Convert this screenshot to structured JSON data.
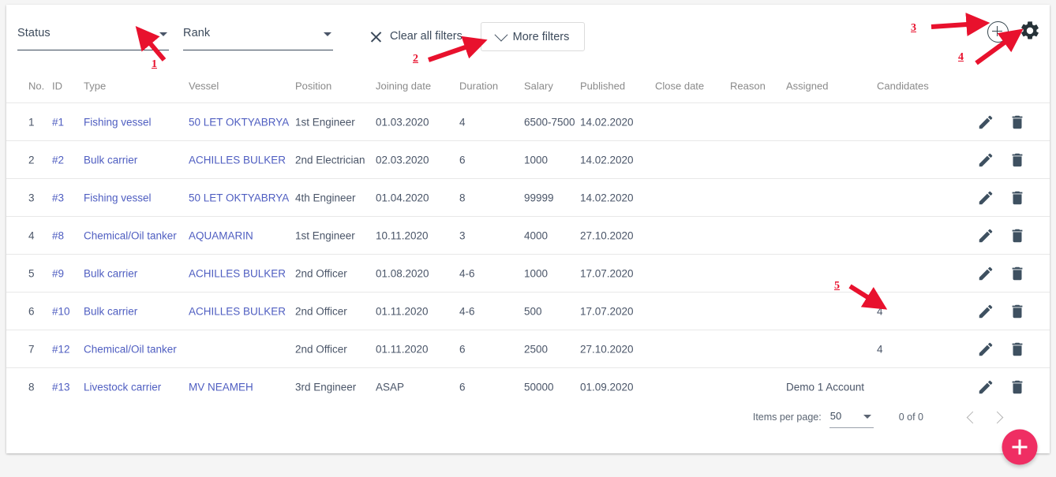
{
  "toolbar": {
    "status_filter": {
      "label": "Status",
      "icon": "chevron-down-icon"
    },
    "rank_filter": {
      "label": "Rank",
      "icon": "chevron-down-icon"
    },
    "clear_all_filters": "Clear all filters",
    "more_filters": "More filters",
    "add_icon": "plus-circle-icon",
    "settings_icon": "gear-icon"
  },
  "table": {
    "columns": [
      "No.",
      "ID",
      "Type",
      "Vessel",
      "Position",
      "Joining date",
      "Duration",
      "Salary",
      "Published",
      "Close date",
      "Reason",
      "Assigned",
      "Candidates"
    ],
    "rows": [
      {
        "no": "1",
        "id": "#1",
        "type": "Fishing vessel",
        "vessel": "50 LET OKTYABRYA",
        "position": "1st Engineer",
        "joining_date": "01.03.2020",
        "duration": "4",
        "salary": "6500-7500",
        "published": "14.02.2020",
        "close_date": "",
        "reason": "",
        "assigned": "",
        "candidates": ""
      },
      {
        "no": "2",
        "id": "#2",
        "type": "Bulk carrier",
        "vessel": "ACHILLES BULKER",
        "position": "2nd Electrician",
        "joining_date": "02.03.2020",
        "duration": "6",
        "salary": "1000",
        "published": "14.02.2020",
        "close_date": "",
        "reason": "",
        "assigned": "",
        "candidates": ""
      },
      {
        "no": "3",
        "id": "#3",
        "type": "Fishing vessel",
        "vessel": "50 LET OKTYABRYA",
        "position": "4th Engineer",
        "joining_date": "01.04.2020",
        "duration": "8",
        "salary": "99999",
        "published": "14.02.2020",
        "close_date": "",
        "reason": "",
        "assigned": "",
        "candidates": ""
      },
      {
        "no": "4",
        "id": "#8",
        "type": "Chemical/Oil tanker",
        "vessel": "AQUAMARIN",
        "position": "1st Engineer",
        "joining_date": "10.11.2020",
        "duration": "3",
        "salary": "4000",
        "published": "27.10.2020",
        "close_date": "",
        "reason": "",
        "assigned": "",
        "candidates": ""
      },
      {
        "no": "5",
        "id": "#9",
        "type": "Bulk carrier",
        "vessel": "ACHILLES BULKER",
        "position": "2nd Officer",
        "joining_date": "01.08.2020",
        "duration": "4-6",
        "salary": "1000",
        "published": "17.07.2020",
        "close_date": "",
        "reason": "",
        "assigned": "",
        "candidates": ""
      },
      {
        "no": "6",
        "id": "#10",
        "type": "Bulk carrier",
        "vessel": "ACHILLES BULKER",
        "position": "2nd Officer",
        "joining_date": "01.11.2020",
        "duration": "4-6",
        "salary": "500",
        "published": "17.07.2020",
        "close_date": "",
        "reason": "",
        "assigned": "",
        "candidates": "4"
      },
      {
        "no": "7",
        "id": "#12",
        "type": "Chemical/Oil tanker",
        "vessel": "",
        "position": "2nd Officer",
        "joining_date": "01.11.2020",
        "duration": "6",
        "salary": "2500",
        "published": "27.10.2020",
        "close_date": "",
        "reason": "",
        "assigned": "",
        "candidates": "4"
      },
      {
        "no": "8",
        "id": "#13",
        "type": "Livestock carrier",
        "vessel": "MV NEAMEH",
        "position": "3rd Engineer",
        "joining_date": "ASAP",
        "duration": "6",
        "salary": "50000",
        "published": "01.09.2020",
        "close_date": "",
        "reason": "",
        "assigned": "Demo 1 Account",
        "candidates": ""
      }
    ],
    "row_actions": {
      "edit_icon": "pencil-icon",
      "delete_icon": "trash-icon"
    }
  },
  "paginator": {
    "items_per_page_label": "Items per page:",
    "items_per_page_value": "50",
    "range_label": "0 of 0",
    "prev_icon": "chevron-left-icon",
    "next_icon": "chevron-right-icon"
  },
  "fab": {
    "icon": "plus-icon"
  },
  "annotations": [
    {
      "number": "1"
    },
    {
      "number": "2"
    },
    {
      "number": "3"
    },
    {
      "number": "4"
    },
    {
      "number": "5"
    }
  ],
  "colors": {
    "link": "#4f5ec1",
    "text": "#4a5568",
    "header_text": "#8a8a8a",
    "fab": "#ef2e63",
    "annotation": "#e8112d",
    "border": "#e8e8e8"
  }
}
